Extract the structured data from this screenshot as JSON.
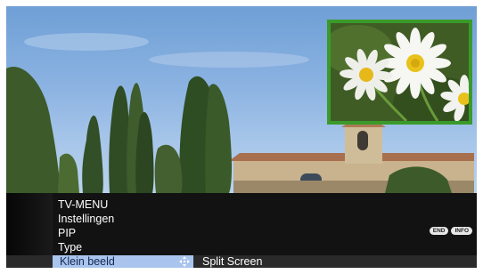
{
  "menu": {
    "items": [
      {
        "label": "TV-MENU"
      },
      {
        "label": "Instellingen"
      },
      {
        "label": "PIP"
      },
      {
        "label": "Type"
      }
    ],
    "selected": {
      "label": "Klein beeld",
      "value": "Split Screen",
      "icon": "four-way-arrow-icon"
    },
    "buttons": [
      {
        "label": "END"
      },
      {
        "label": "INFO"
      }
    ]
  },
  "colors": {
    "pip_border": "#3a9a2a",
    "selection": "#a9c5ee",
    "panel": "#121212"
  }
}
